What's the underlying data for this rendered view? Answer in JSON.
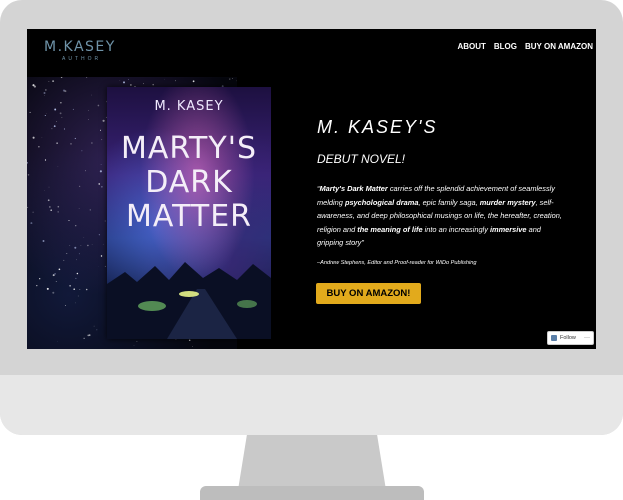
{
  "header": {
    "logo": "M.KASEY",
    "logo_sub": "AUTHOR",
    "nav": [
      "ABOUT",
      "BLOG",
      "BUY ON AMAZON"
    ]
  },
  "book": {
    "author": "M. KASEY",
    "title_lines": [
      "MARTY'S",
      "DARK",
      "MATTER"
    ]
  },
  "hero": {
    "title": "M. KASEY'S",
    "subtitle": "DEBUT NOVEL!",
    "quote_parts": [
      {
        "text": "“",
        "bold": false
      },
      {
        "text": "Marty's Dark Matter",
        "bold": true
      },
      {
        "text": " carries off the splendid achievement of seamlessly melding ",
        "bold": false
      },
      {
        "text": "psychological drama",
        "bold": true
      },
      {
        "text": ", epic family saga, ",
        "bold": false
      },
      {
        "text": "murder mystery",
        "bold": true
      },
      {
        "text": ", self-awareness, and deep philosophical musings on life, the hereafter, creation, religion and ",
        "bold": false
      },
      {
        "text": "the meaning of life",
        "bold": true
      },
      {
        "text": " into an increasingly ",
        "bold": false
      },
      {
        "text": "immersive",
        "bold": true
      },
      {
        "text": " and gripping story”",
        "bold": false
      }
    ],
    "citation": "–Andrew Stephens, Editor and Proof-reader for WiDo Publishing",
    "buy_label": "BUY ON AMAZON!"
  },
  "follow": {
    "label": "Follow",
    "more": "···"
  },
  "colors": {
    "accent": "#e2aa1c",
    "logo": "#6f93a8",
    "background": "#000000"
  }
}
